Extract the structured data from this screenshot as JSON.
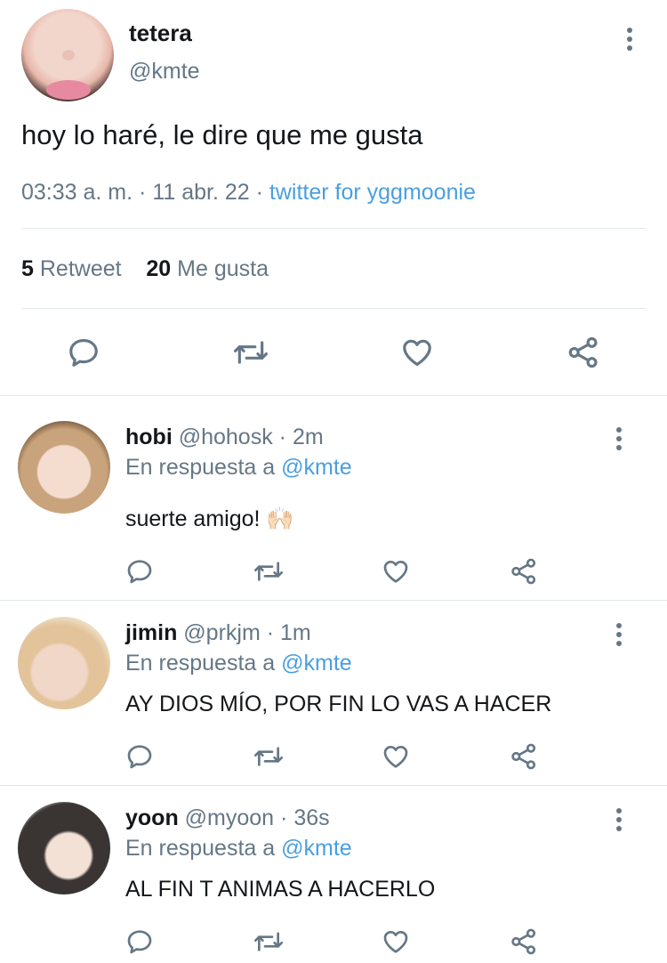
{
  "main_tweet": {
    "name": "tetera",
    "handle": "@kmte",
    "text": "hoy lo haré, le dire que me gusta",
    "time": "03:33 a. m.",
    "dot1": "·",
    "date": "11 abr. 22",
    "dot2": "·",
    "source": "twitter for yggmoonie",
    "retweets_count": "5",
    "retweets_label": "Retweet",
    "likes_count": "20",
    "likes_label": "Me gusta",
    "actions": [
      "reply-icon",
      "retweet-icon",
      "like-icon",
      "share-icon"
    ]
  },
  "replies": [
    {
      "name": "hobi",
      "handle": "@hohosk",
      "dot": "·",
      "time": "2m",
      "reply_prefix": "En respuesta a",
      "mention": "@kmte",
      "text": "suerte amigo! 🙌🏻"
    },
    {
      "name": "jimin",
      "handle": "@prkjm",
      "dot": "·",
      "time": "1m",
      "reply_prefix": "En respuesta a",
      "mention": "@kmte",
      "text": "AY DIOS MÍO, POR FIN LO VAS A HACER"
    },
    {
      "name": "yoon",
      "handle": "@myoon",
      "dot": "·",
      "time": "36s",
      "reply_prefix": "En respuesta a",
      "mention": "@kmte",
      "text": "AL FIN T ANIMAS A HACERLO"
    }
  ],
  "colors": {
    "link": "#4a9fe0",
    "secondary_text": "#657786",
    "primary_text": "#14171a",
    "divider": "#e1e8ed"
  }
}
